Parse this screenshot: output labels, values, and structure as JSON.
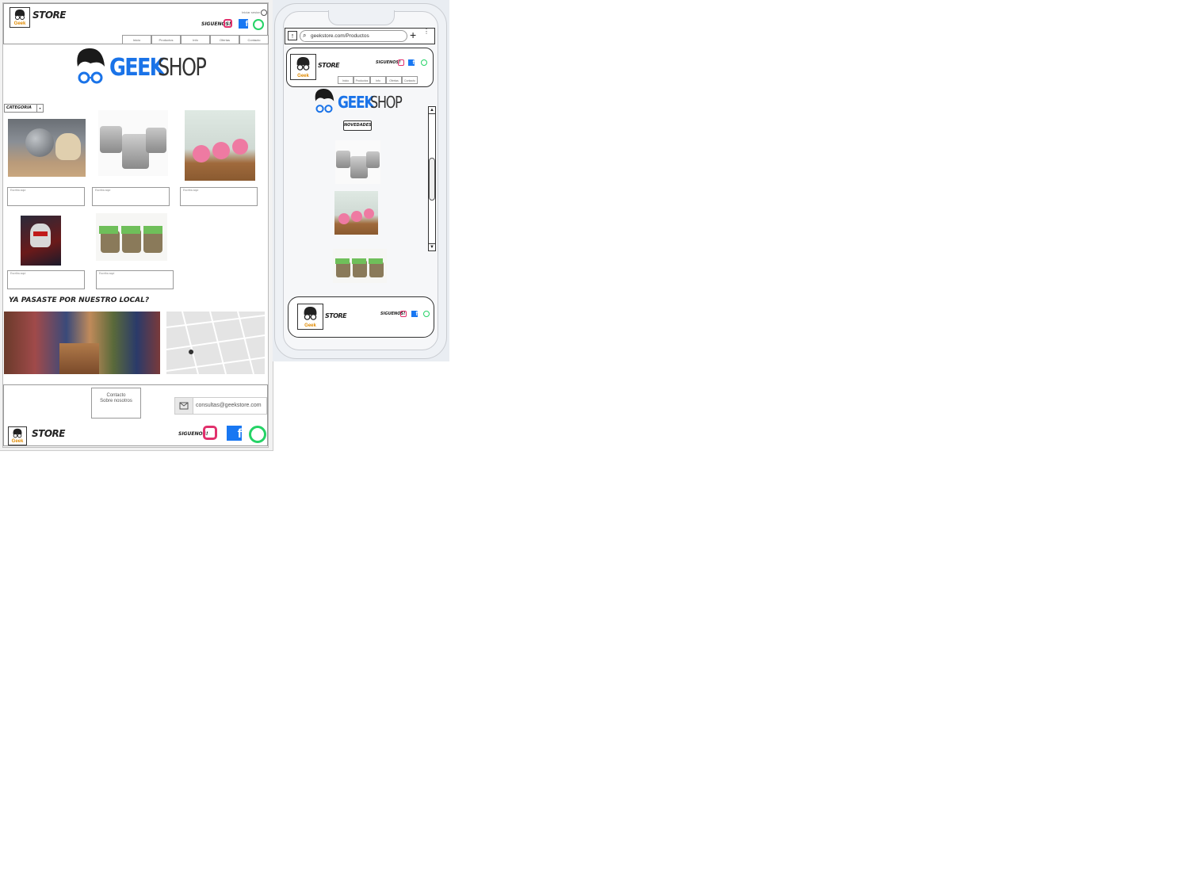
{
  "brand": {
    "store": "STORE",
    "logo_label": "Geek",
    "geek": "GEEK",
    "shop": "SHOP"
  },
  "desktop": {
    "header": {
      "login": "Iniciar sesion",
      "follow": "SIGUENOS!"
    },
    "nav": [
      "Inicio",
      "Productos",
      "Info",
      "Ofertas",
      "Contacto"
    ],
    "category": "CATEGORIA",
    "product_captions": [
      "Escriba aqui",
      "Escriba aqui",
      "Escriba aqui",
      "Escriba aqui",
      "Escriba aqui"
    ],
    "local_heading": "YA PASASTE POR NUESTRO LOCAL?",
    "footer": {
      "links": [
        "Contacto",
        "Sobre nosotros"
      ],
      "email": "consultas@geekstore.com",
      "follow": "SIGUENOS!"
    }
  },
  "mobile": {
    "url": "geekstore.com/Productos",
    "follow": "SIGUENOS!",
    "nav": [
      "Inicio",
      "Productos",
      "Info",
      "Ofertas",
      "Contacto"
    ],
    "novedades": "NOVEDADES"
  },
  "colors": {
    "instagram": "#e1306c",
    "facebook": "#1877f2",
    "whatsapp": "#25d366",
    "geek_blue": "#1a73e8"
  }
}
